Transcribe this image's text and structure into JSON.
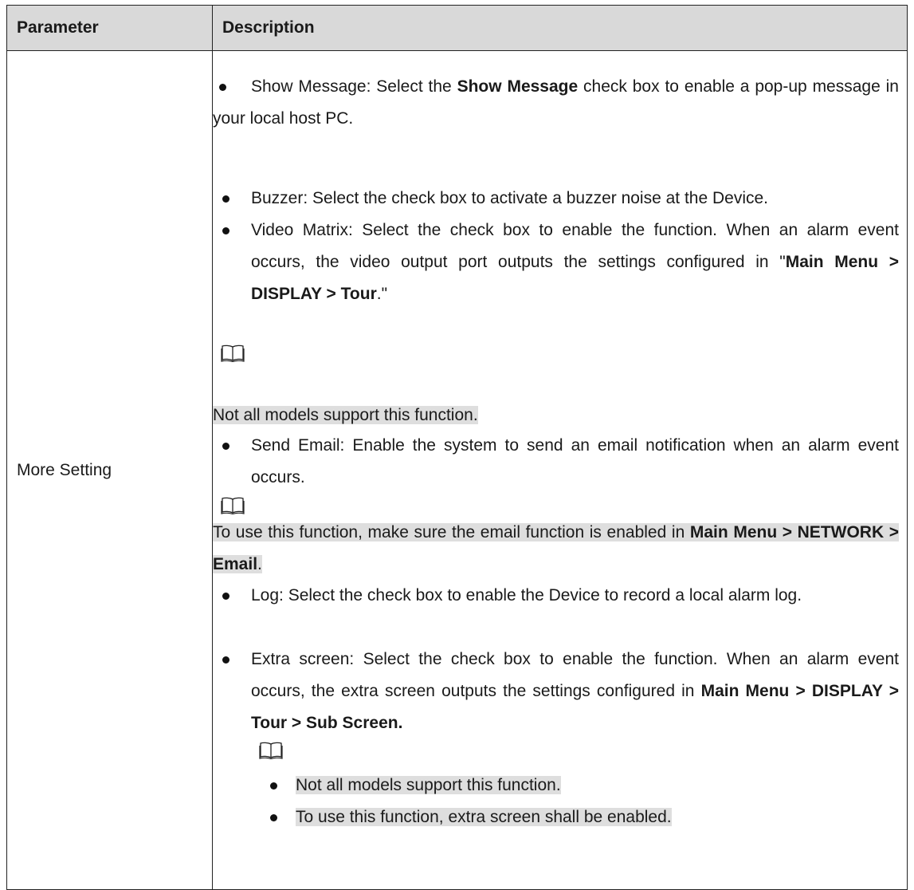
{
  "header": {
    "parameter": "Parameter",
    "description": "Description"
  },
  "row": {
    "parameter": "More Setting"
  },
  "items": {
    "show_message": {
      "lead": "Show Message: Select the ",
      "bold": "Show Message",
      "rest": " check box to enable a pop-up message in your local host PC."
    },
    "buzzer": "Buzzer: Select the check box to activate a buzzer noise at the Device.",
    "video_matrix": {
      "lead": "Video Matrix: Select the check box to enable the function. When an alarm event occurs, the video output port outputs the settings configured in \"",
      "bold": "Main Menu > DISPLAY > Tour",
      "end": ".\""
    },
    "note1": "Not all models support this function.",
    "send_email": "Send Email: Enable the system to send an email notification when an alarm event occurs.",
    "note2": {
      "lead": "To use this function, make sure the email function is enabled in ",
      "bold": "Main Menu > NETWORK > Email",
      "end": "."
    },
    "log": "Log: Select the check box to enable the Device to record a local alarm log.",
    "extra_screen": {
      "lead": "Extra screen: Select the check box to enable the function. When an alarm event occurs, the extra screen outputs the settings configured in ",
      "bold": "Main Menu > DISPLAY > Tour > Sub Screen."
    },
    "note3_items": [
      "Not all models support this function.",
      "To use this function, extra screen shall be enabled."
    ]
  },
  "icons": {
    "note": "open-book-note-icon",
    "bullet": "bullet-dot-icon"
  }
}
